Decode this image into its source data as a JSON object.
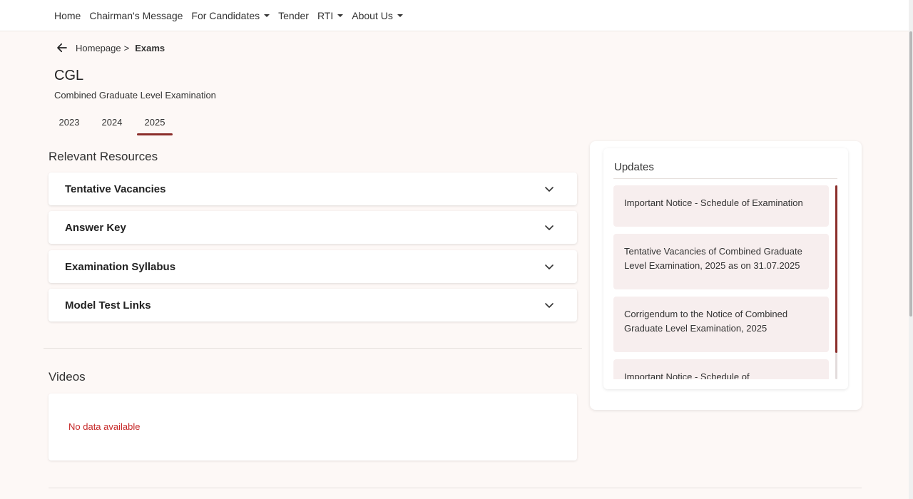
{
  "nav": {
    "items": [
      {
        "label": "Home",
        "dropdown": false
      },
      {
        "label": "Chairman's Message",
        "dropdown": false
      },
      {
        "label": "For Candidates",
        "dropdown": true
      },
      {
        "label": "Tender",
        "dropdown": false
      },
      {
        "label": "RTI",
        "dropdown": true
      },
      {
        "label": "About Us",
        "dropdown": true
      }
    ]
  },
  "breadcrumb": {
    "home": "Homepage",
    "separator": ">",
    "current": "Exams"
  },
  "exam": {
    "title": "CGL",
    "subtitle": "Combined Graduate Level Examination"
  },
  "years": {
    "tabs": [
      "2023",
      "2024",
      "2025"
    ],
    "selected": "2025"
  },
  "resources": {
    "heading": "Relevant Resources",
    "items": [
      "Tentative Vacancies",
      "Answer Key",
      "Examination Syllabus",
      "Model Test Links"
    ]
  },
  "videos": {
    "heading": "Videos",
    "empty_text": "No data available"
  },
  "updates": {
    "title": "Updates",
    "items": [
      "Important Notice - Schedule of Examination",
      "Tentative Vacancies of Combined Graduate Level Examination, 2025 as on 31.07.2025",
      "Corrigendum to the Notice of Combined Graduate Level Examination, 2025",
      "Important Notice - Schedule of"
    ]
  },
  "colors": {
    "accent": "#8b2e2b",
    "background": "#fdf8f6",
    "update_item_bg": "#f7eeee",
    "empty_text": "#c62828"
  }
}
